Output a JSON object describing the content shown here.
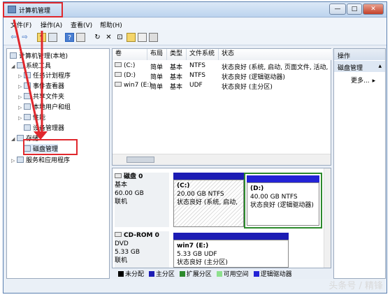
{
  "window": {
    "title": "计算机管理",
    "min": "—",
    "max": "□",
    "close": "✕"
  },
  "menu": [
    "文件(F)",
    "操作(A)",
    "查看(V)",
    "帮助(H)"
  ],
  "toolbar": {
    "back": "⇦",
    "forward": "⇨",
    "up": "↑",
    "refresh": "↻",
    "delete": "✕",
    "props": "⊡",
    "help": "?"
  },
  "tree": {
    "root": "计算机管理(本地)",
    "system_tools": "系统工具",
    "task_scheduler": "任务计划程序",
    "event_viewer": "事件查看器",
    "shared_folders": "共享文件夹",
    "local_users": "本地用户和组",
    "performance": "性能",
    "device_manager": "设备管理器",
    "storage": "存储",
    "disk_management": "磁盘管理",
    "services": "服务和应用程序"
  },
  "columns": [
    "卷",
    "布局",
    "类型",
    "文件系统",
    "状态"
  ],
  "volumes": [
    {
      "name": "(C:)",
      "layout": "简单",
      "type": "基本",
      "fs": "NTFS",
      "status": "状态良好 (系统, 启动, 页面文件, 活动,"
    },
    {
      "name": "(D:)",
      "layout": "简单",
      "type": "基本",
      "fs": "NTFS",
      "status": "状态良好 (逻辑驱动器)"
    },
    {
      "name": "win7 (E:)",
      "layout": "简单",
      "type": "基本",
      "fs": "UDF",
      "status": "状态良好 (主分区)"
    }
  ],
  "actions": {
    "title": "操作",
    "section": "磁盘管理",
    "more": "更多..."
  },
  "disk0": {
    "name": "磁盘 0",
    "type": "基本",
    "size": "60.00 GB",
    "state": "联机",
    "c": {
      "label": "(C:)",
      "size": "20.00 GB NTFS",
      "status": "状态良好 (系统, 启动,"
    },
    "d": {
      "label": "(D:)",
      "size": "40.00 GB NTFS",
      "status": "状态良好 (逻辑驱动器)"
    }
  },
  "cdrom": {
    "name": "CD-ROM 0",
    "type": "DVD",
    "size": "5.33 GB",
    "state": "联机",
    "e": {
      "label": "win7  (E:)",
      "size": "5.33 GB UDF",
      "status": "状态良好 (主分区)"
    }
  },
  "legend": [
    "未分配",
    "主分区",
    "扩展分区",
    "可用空间",
    "逻辑驱动器"
  ],
  "colors": {
    "unallocated": "#000000",
    "primary": "#1c1cb4",
    "extended": "#2d8a2d",
    "free": "#8ee08e",
    "logical": "#2323d6"
  },
  "watermark": "头条号 / 精锋"
}
